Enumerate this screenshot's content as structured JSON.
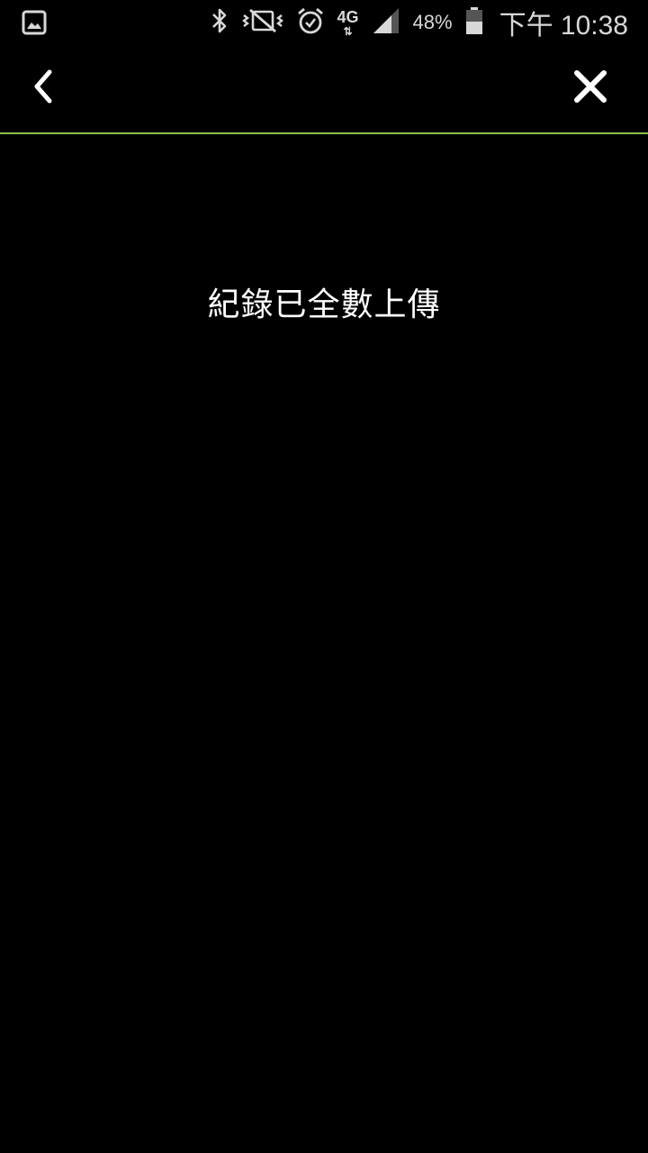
{
  "status_bar": {
    "network_type": "4G",
    "network_arrows": "⇅",
    "battery_percent": "48%",
    "time": "下午 10:38",
    "icons": [
      "gallery-icon",
      "bluetooth-icon",
      "vibrate-mute-icon",
      "alarm-icon",
      "signal-icon",
      "battery-icon"
    ]
  },
  "app_bar": {
    "back_icon": "chevron-left-icon",
    "close_icon": "close-icon",
    "divider_color": "#8bc34a"
  },
  "main": {
    "message": "紀錄已全數上傳"
  },
  "colors": {
    "background": "#000000",
    "text": "#ffffff",
    "status_text": "#d8d8d8",
    "accent": "#8bc34a"
  }
}
